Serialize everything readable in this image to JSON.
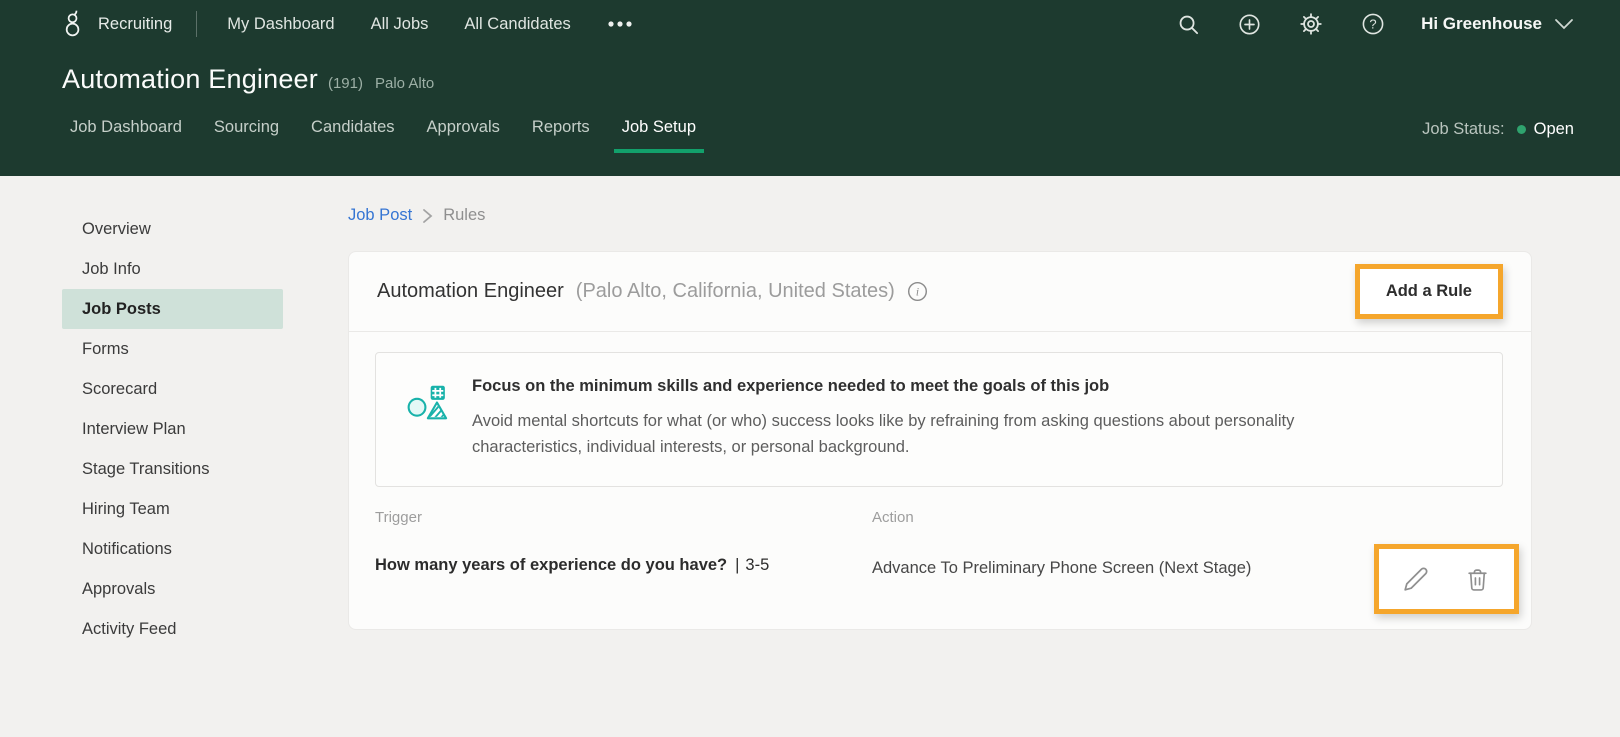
{
  "topnav": {
    "product": "Recruiting",
    "items": [
      {
        "label": "My Dashboard"
      },
      {
        "label": "All Jobs"
      },
      {
        "label": "All Candidates"
      }
    ],
    "user_menu": "Hi Greenhouse"
  },
  "job_header": {
    "title": "Automation Engineer",
    "req_id": "(191)",
    "location": "Palo Alto",
    "tabs": [
      "Job Dashboard",
      "Sourcing",
      "Candidates",
      "Approvals",
      "Reports",
      "Job Setup"
    ],
    "active_tab": "Job Setup",
    "status_label": "Job Status:",
    "status_value": "Open"
  },
  "sidebar": {
    "active": "Job Posts",
    "items": [
      "Overview",
      "Job Info",
      "Job Posts",
      "Forms",
      "Scorecard",
      "Interview Plan",
      "Stage Transitions",
      "Hiring Team",
      "Notifications",
      "Approvals",
      "Activity Feed"
    ]
  },
  "breadcrumb": {
    "link": "Job Post",
    "current": "Rules"
  },
  "rules_card": {
    "title": "Automation Engineer",
    "subtitle": "(Palo Alto, California, United States)",
    "add_rule_label": "Add a Rule",
    "tip": {
      "heading": "Focus on the minimum skills and experience needed to meet the goals of this job",
      "body": "Avoid mental shortcuts for what (or who) success looks like by refraining from asking questions about personality characteristics, individual interests, or personal background."
    },
    "table": {
      "trigger_header": "Trigger",
      "action_header": "Action",
      "rows": [
        {
          "trigger_question": "How many years of experience do you have?",
          "trigger_separator": "|",
          "trigger_value": "3-5",
          "action": "Advance To Preliminary Phone Screen (Next Stage)"
        }
      ]
    }
  },
  "icons": {
    "nav": [
      "search-icon",
      "add-icon",
      "gear-icon",
      "help-icon",
      "chevron-down-icon"
    ],
    "row_actions": [
      "pencil-icon",
      "trash-icon"
    ],
    "tip_icon": "shapes-diversity-icon"
  },
  "colors": {
    "header_green": "#1d3a2f",
    "active_tab_underline": "#12a06b",
    "status_open_dot": "#2fa36e",
    "sidebar_active_bg": "#cfe1d9",
    "annotation_orange": "#f5a62c",
    "breadcrumb_link_blue": "#3575d3",
    "tip_icon_teal": "#18b2aa",
    "page_background": "#f2f1ef"
  }
}
